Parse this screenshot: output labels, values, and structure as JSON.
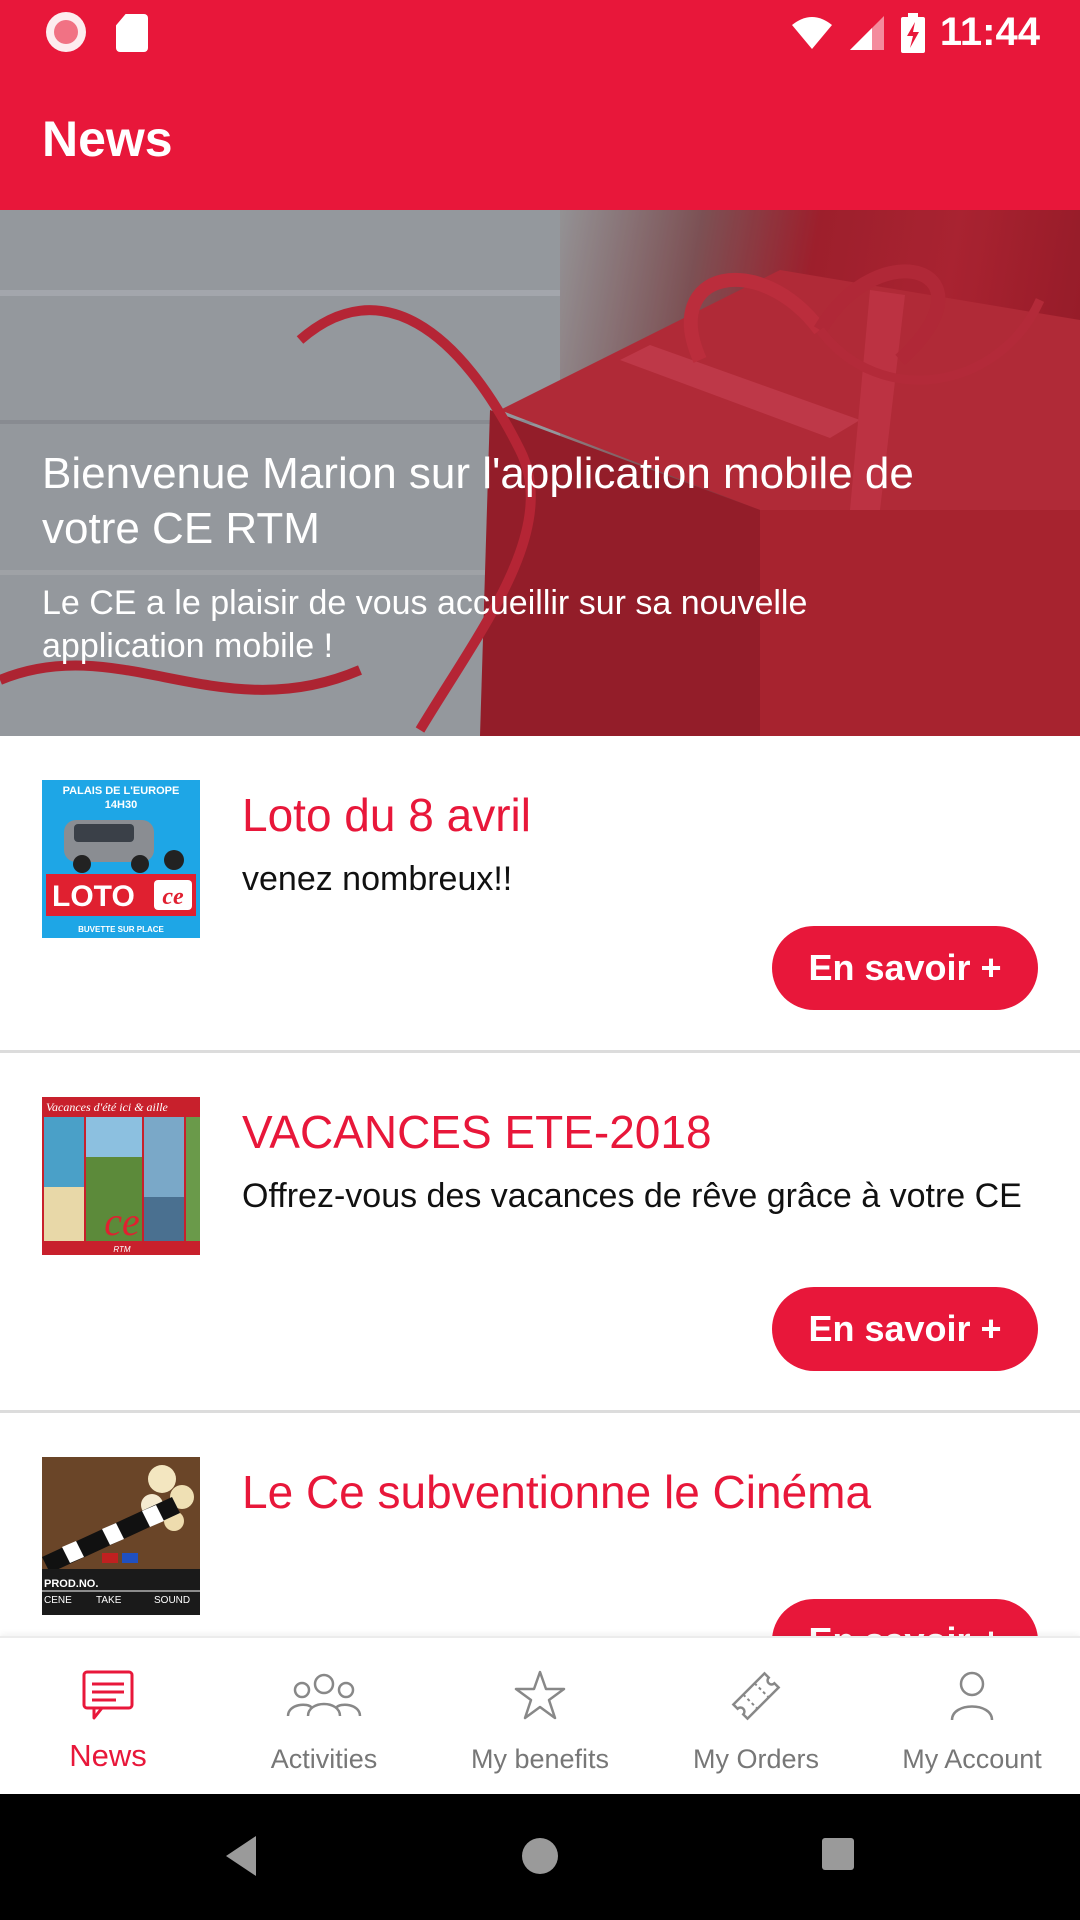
{
  "status_bar": {
    "time": "11:44"
  },
  "app_bar": {
    "title": "News"
  },
  "hero": {
    "title": "Bienvenue Marion  sur l'application mobile de votre CE RTM",
    "subtitle": "Le CE a le plaisir de vous accueillir sur sa nouvelle application mobile !"
  },
  "news": [
    {
      "title": "Loto du 8 avril",
      "description": "venez nombreux!!",
      "button": "En savoir +",
      "thumb_text": [
        "PALAIS DE L'EUROPE",
        "14H30",
        "LOTO",
        "ce",
        "BUVETTE SUR PLACE"
      ]
    },
    {
      "title": "VACANCES ETE-2018",
      "description": "Offrez-vous des vacances de rêve grâce à votre CE",
      "button": "En savoir +",
      "thumb_text": [
        "Vacances d'été ici & aille",
        "ce",
        "RTM"
      ]
    },
    {
      "title": "Le Ce subventionne le Cinéma",
      "description": "",
      "button": "En savoir +",
      "thumb_text": [
        "PROD.NO.",
        "CENE",
        "TAKE",
        "SOUND"
      ]
    }
  ],
  "bottom_nav": [
    {
      "label": "News",
      "icon": "news-icon",
      "active": true
    },
    {
      "label": "Activities",
      "icon": "people-icon",
      "active": false
    },
    {
      "label": "My benefits",
      "icon": "star-icon",
      "active": false
    },
    {
      "label": "My Orders",
      "icon": "ticket-icon",
      "active": false
    },
    {
      "label": "My Account",
      "icon": "user-icon",
      "active": false
    }
  ],
  "colors": {
    "accent": "#e8173a",
    "nav_inactive": "#777777"
  }
}
